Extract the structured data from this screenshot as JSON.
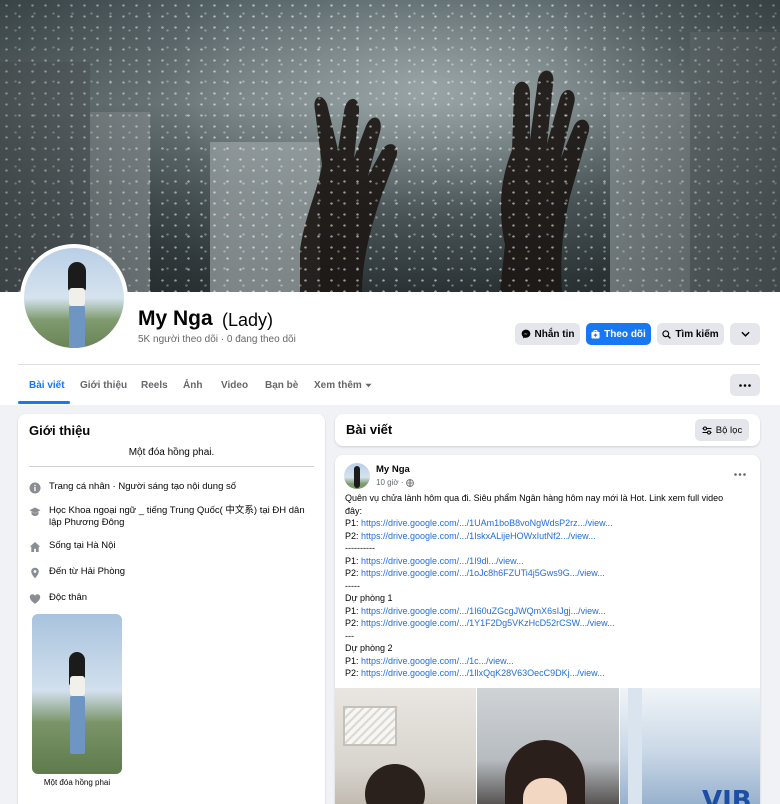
{
  "profile": {
    "name": "My Nga",
    "alternate_name": "(Lady)",
    "stats": "5K người theo dõi · 0 đang theo dõi"
  },
  "actions": {
    "message_label": "Nhắn tin",
    "follow_label": "Theo dõi",
    "search_label": "Tìm kiếm"
  },
  "tabs": [
    {
      "label": "Bài viết",
      "active": true
    },
    {
      "label": "Giới thiệu"
    },
    {
      "label": "Reels"
    },
    {
      "label": "Ảnh"
    },
    {
      "label": "Video"
    },
    {
      "label": "Bạn bè"
    },
    {
      "label": "Xem thêm"
    }
  ],
  "intro": {
    "title": "Giới thiệu",
    "bio": "Một đóa hồng phai.",
    "items": [
      {
        "icon": "info-icon",
        "text": "Trang cá nhân · Người sáng tạo nội dung số"
      },
      {
        "icon": "graduation-cap-icon",
        "text": "Học Khoa ngoại ngữ _ tiếng Trung Quốc( 中文系)   tại ĐH dân lập Phương Đông"
      },
      {
        "icon": "home-icon",
        "text": "Sống tại Hà Nội"
      },
      {
        "icon": "location-pin-icon",
        "text": "Đến từ Hải Phòng"
      },
      {
        "icon": "heart-icon",
        "text": "Độc thân"
      }
    ],
    "featured_caption": "Một đóa hồng phai"
  },
  "posts_header": {
    "title": "Bài viết",
    "filter_label": "Bộ lọc"
  },
  "post": {
    "author": "My Nga",
    "time": "10 giờ ·",
    "lines": [
      {
        "text": "Quên vụ chửa lành hôm qua đi. Siêu phẩm Ngân hàng hôm nay mới là Hot. Link xem full video"
      },
      {
        "text": "đây:"
      },
      {
        "prefix": "P1: ",
        "link": "https://drive.google.com/.../1UAm1boB8voNgWdsP2rz.../view..."
      },
      {
        "prefix": "P2: ",
        "link": "https://drive.google.com/.../1IskxALijeHOWxIutNf2.../view..."
      },
      {
        "text": "----------"
      },
      {
        "prefix": "P1: ",
        "link": "https://drive.google.com/.../1I9dl.../view..."
      },
      {
        "prefix": "P2: ",
        "link": "https://drive.google.com/.../1oJc8h6FZUTi4j5Gws9G.../view..."
      },
      {
        "text": "-----"
      },
      {
        "text": "Dự phòng 1"
      },
      {
        "prefix": "P1: ",
        "link": "https://drive.google.com/.../1I60uZGcgJWQmX6sIJgj.../view..."
      },
      {
        "prefix": "P2: ",
        "link": "https://drive.google.com/.../1Y1F2Dg5VKzHcD52rCSW.../view..."
      },
      {
        "text": "---"
      },
      {
        "text": "Dự phòng 2"
      },
      {
        "prefix": "P1: ",
        "link": "https://drive.google.com/.../1c.../view..."
      },
      {
        "prefix": "P2: ",
        "link": "https://drive.google.com/.../1IlxQqK28V63OecC9DKj.../view..."
      }
    ],
    "media_text": "VIB"
  },
  "colors": {
    "accent": "#1877f2",
    "link": "#216fdb",
    "secondary_text": "#65676b",
    "page_bg": "#f0f2f5"
  }
}
